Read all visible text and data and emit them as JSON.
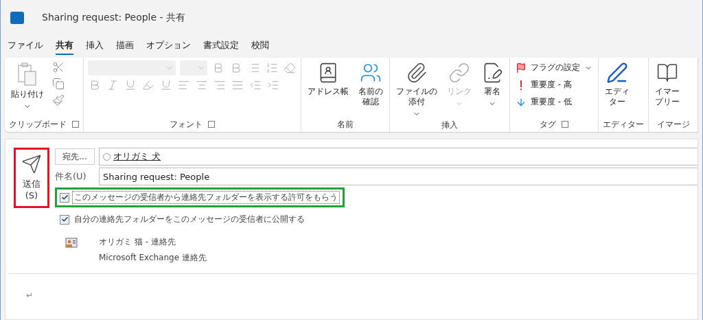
{
  "window": {
    "title": "Sharing request: People  -  共有"
  },
  "tabs": [
    {
      "label": "ファイル",
      "selected": false
    },
    {
      "label": "共有",
      "selected": true
    },
    {
      "label": "挿入",
      "selected": false
    },
    {
      "label": "描画",
      "selected": false
    },
    {
      "label": "オプション",
      "selected": false
    },
    {
      "label": "書式設定",
      "selected": false
    },
    {
      "label": "校閲",
      "selected": false
    }
  ],
  "ribbon": {
    "groups": [
      {
        "kind": "clipboard",
        "label": "クリップボード",
        "launcher": true,
        "items": [
          {
            "kind": "paste",
            "label": "貼り付け",
            "disabled": false
          }
        ]
      },
      {
        "kind": "font",
        "label": "フォント",
        "launcher": true
      },
      {
        "kind": "buttons",
        "label": "名前",
        "launcher": false,
        "items": [
          {
            "kind": "address_book",
            "label": "アドレス帳",
            "disabled": false
          },
          {
            "kind": "check_names",
            "label": "名前の確認",
            "disabled": false
          }
        ]
      },
      {
        "kind": "buttons",
        "label": "挿入",
        "launcher": false,
        "items": [
          {
            "kind": "attach",
            "label": "ファイルの添付",
            "disabled": false,
            "menu": true
          },
          {
            "kind": "link",
            "label": "リンク",
            "disabled": true,
            "menu": true
          },
          {
            "kind": "signature",
            "label": "署名",
            "disabled": false,
            "menu": true
          }
        ]
      },
      {
        "kind": "tags",
        "label": "タグ",
        "launcher": true,
        "items": [
          {
            "kind": "flag",
            "label": "フラグの設定",
            "disabled": false,
            "menu": true
          },
          {
            "kind": "high",
            "label": "重要度 - 高",
            "disabled": false
          },
          {
            "kind": "low",
            "label": "重要度 - 低",
            "disabled": false
          }
        ]
      },
      {
        "kind": "buttons",
        "label": "エディター",
        "launcher": false,
        "items": [
          {
            "kind": "editor",
            "label": "エディター",
            "disabled": false
          }
        ]
      },
      {
        "kind": "buttons",
        "label": "イマージ",
        "launcher": false,
        "items": [
          {
            "kind": "reader",
            "label": "イマーブリー",
            "disabled": false
          }
        ]
      }
    ]
  },
  "compose": {
    "send": {
      "label": "送信\n(S)",
      "highlighted": true
    },
    "to_button": "宛先...",
    "recipient": "オリガミ 犬",
    "subject_label": "件名(U)",
    "subject": "Sharing request: People",
    "options": [
      {
        "label": "このメッセージの受信者から連絡先フォルダーを表示する許可をもらう",
        "checked": true,
        "highlighted": true
      },
      {
        "label": "自分の連絡先フォルダーをこのメッセージの受信者に公開する",
        "checked": true,
        "highlighted": false
      }
    ],
    "attachment": {
      "name": "オリガミ 猫 - 連絡先",
      "source": "Microsoft Exchange 連絡先"
    },
    "body": "↵"
  }
}
